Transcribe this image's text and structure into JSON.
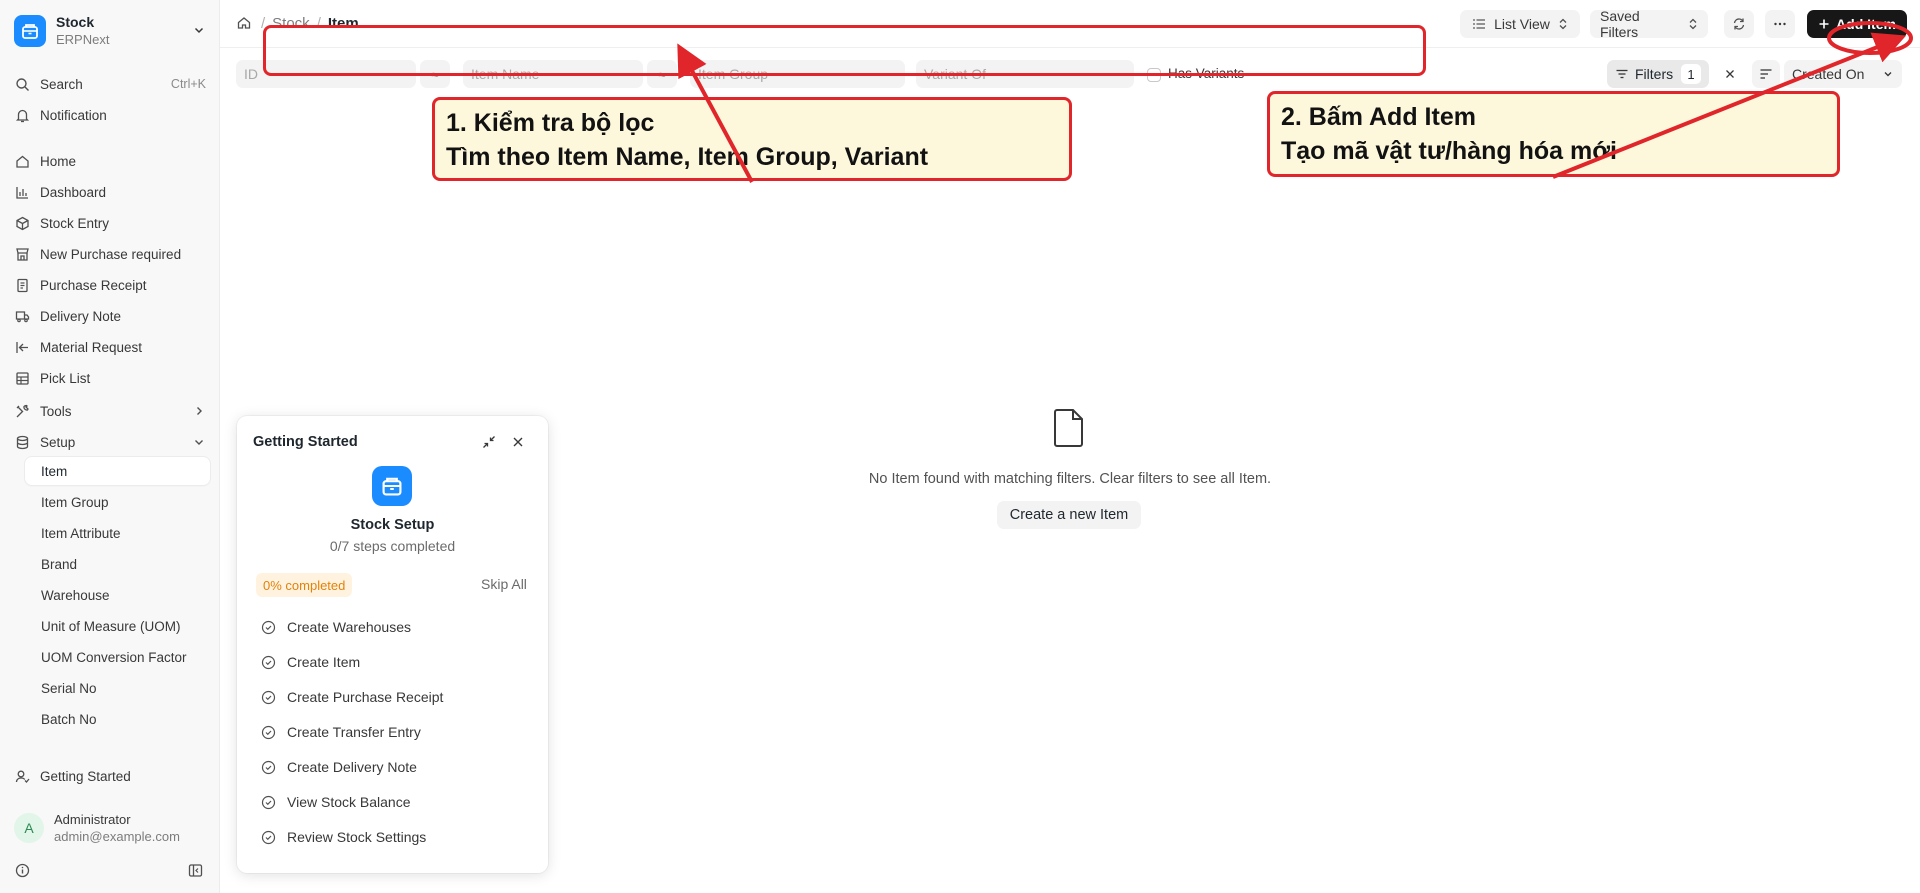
{
  "app": {
    "title": "Stock",
    "subtitle": "ERPNext"
  },
  "sidebar": {
    "search_label": "Search",
    "search_shortcut": "Ctrl+K",
    "notification_label": "Notification",
    "items": [
      {
        "label": "Home",
        "icon": "home-icon"
      },
      {
        "label": "Dashboard",
        "icon": "bar-chart-icon"
      },
      {
        "label": "Stock Entry",
        "icon": "box-icon"
      },
      {
        "label": "New Purchase required",
        "icon": "store-icon"
      },
      {
        "label": "Purchase Receipt",
        "icon": "document-icon"
      },
      {
        "label": "Delivery Note",
        "icon": "truck-icon"
      },
      {
        "label": "Material Request",
        "icon": "arrow-left-bar-icon"
      },
      {
        "label": "Pick List",
        "icon": "grid-list-icon"
      },
      {
        "label": "Tools",
        "icon": "tools-icon"
      },
      {
        "label": "Setup",
        "icon": "database-icon"
      }
    ],
    "setup_children": [
      {
        "label": "Item",
        "active": true
      },
      {
        "label": "Item Group"
      },
      {
        "label": "Item Attribute"
      },
      {
        "label": "Brand"
      },
      {
        "label": "Warehouse"
      },
      {
        "label": "Unit of Measure (UOM)"
      },
      {
        "label": "UOM Conversion Factor"
      },
      {
        "label": "Serial No"
      },
      {
        "label": "Batch No"
      }
    ],
    "getting_started_label": "Getting Started",
    "user": {
      "name": "Administrator",
      "email": "admin@example.com",
      "initial": "A"
    }
  },
  "header": {
    "breadcrumb": [
      "Stock",
      "Item"
    ],
    "list_view_label": "List View",
    "saved_filters_label": "Saved Filters",
    "add_label": "Add Item"
  },
  "filters": {
    "id_placeholder": "ID",
    "item_name_placeholder": "Item Name",
    "item_group_placeholder": "Item Group",
    "variant_of_placeholder": "Variant Of",
    "operator_symbol": "≈",
    "has_variants_label": "Has Variants",
    "filters_label": "Filters",
    "filters_count": "1",
    "sort_by_label": "Created On"
  },
  "empty_state": {
    "message": "No Item found with matching filters. Clear filters to see all Item.",
    "create_label": "Create a new Item"
  },
  "getting_started": {
    "title": "Getting Started",
    "module_name": "Stock Setup",
    "steps_text": "0/7 steps completed",
    "progress_label": "0% completed",
    "progress_fraction": 0,
    "skip_label": "Skip All",
    "steps": [
      "Create Warehouses",
      "Create Item",
      "Create Purchase Receipt",
      "Create Transfer Entry",
      "Create Delivery Note",
      "View Stock Balance",
      "Review Stock Settings"
    ]
  },
  "annotations": {
    "callout1_line1": "1. Kiểm tra bộ lọc",
    "callout1_line2": "Tìm theo Item Name, Item Group, Variant",
    "callout2_line1": "2. Bấm Add Item",
    "callout2_line2": "Tạo mã vật tư/hàng hóa mới",
    "color": "#e0262a"
  },
  "colors": {
    "brand": "#1a8cff",
    "primary_button": "#171717",
    "progress_text": "#e2820a"
  }
}
